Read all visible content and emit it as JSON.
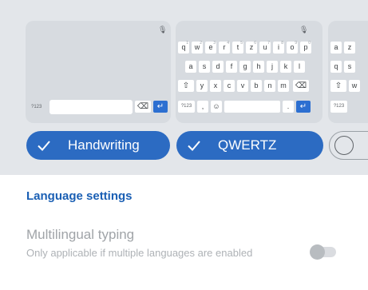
{
  "layouts": {
    "handwriting": {
      "label": "Handwriting",
      "selected": true,
      "preview": {
        "symbols_key": "?123",
        "delete_icon": "backspace-icon",
        "enter_icon": "enter-icon",
        "mic_icon": "mic-icon"
      }
    },
    "qwertz": {
      "label": "QWERTZ",
      "selected": true,
      "preview": {
        "row1": [
          "q",
          "w",
          "e",
          "r",
          "t",
          "z",
          "u",
          "i",
          "o",
          "p"
        ],
        "row1_hints": [
          "1",
          "2",
          "3",
          "4",
          "5",
          "6",
          "7",
          "8",
          "9",
          "0"
        ],
        "row2": [
          "a",
          "s",
          "d",
          "f",
          "g",
          "h",
          "j",
          "k",
          "l"
        ],
        "row3": [
          "y",
          "x",
          "c",
          "v",
          "b",
          "n",
          "m"
        ],
        "symbols_key": "?123",
        "comma": ",",
        "period": ".",
        "emoji_icon": "emoji-icon",
        "shift_icon": "shift-icon",
        "delete_icon": "backspace-icon",
        "enter_icon": "enter-icon",
        "mic_icon": "mic-icon"
      }
    },
    "azerty_partial": {
      "selected": false,
      "preview": {
        "row1": [
          "a",
          "z"
        ],
        "row2": [
          "q",
          "s"
        ],
        "row3": [
          "w"
        ],
        "symbols_key": "?123"
      }
    }
  },
  "language_settings": {
    "title": "Language settings",
    "multilingual": {
      "title": "Multilingual typing",
      "description": "Only applicable if multiple languages are enabled",
      "enabled": false
    }
  },
  "colors": {
    "accent": "#2c6bc2",
    "section_title": "#1a5fb4",
    "panel_bg": "#e3e6ea"
  }
}
